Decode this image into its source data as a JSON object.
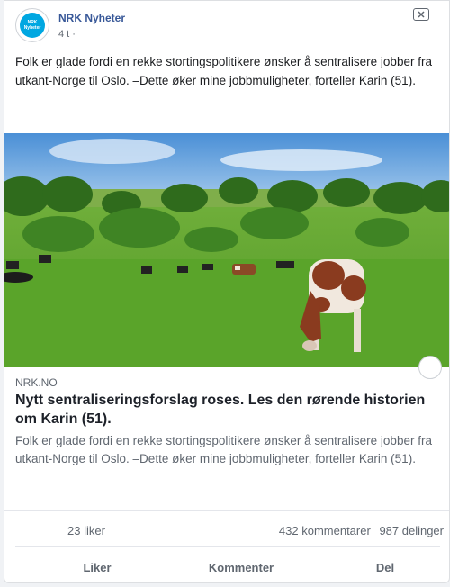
{
  "post": {
    "page_name": "NRK Nyheter",
    "time": "4 t ·",
    "avatar_text_top": "NRK",
    "avatar_text_bottom": "Nyheter",
    "text": "Folk er glade fordi en rekke stortingspolitikere ønsker å sentralisere jobber fra utkant-Norge til Oslo. –Dette øker mine jobbmuligheter, forteller Karin (51).",
    "close_icon": "close-icon"
  },
  "link": {
    "image_icon": "cows-pasture-photo",
    "source": "NRK.NO",
    "title": "Nytt sentraliseringsforslag roses. Les den rørende historien om Karin (51).",
    "description": "Folk er glade fordi en rekke stortingspolitikere ønsker å sentralisere jobber fra utkant-Norge til Oslo. –Dette øker mine jobbmuligheter, forteller Karin (51)."
  },
  "stats": {
    "likes": "23 liker",
    "comments": "432 kommentarer",
    "shares": "987 delinger"
  },
  "actions": {
    "like": "Liker",
    "comment": "Kommenter",
    "share": "Del"
  },
  "colors": {
    "name_link": "#385898",
    "secondary_text": "#606770",
    "brand": "#00a7e1"
  }
}
